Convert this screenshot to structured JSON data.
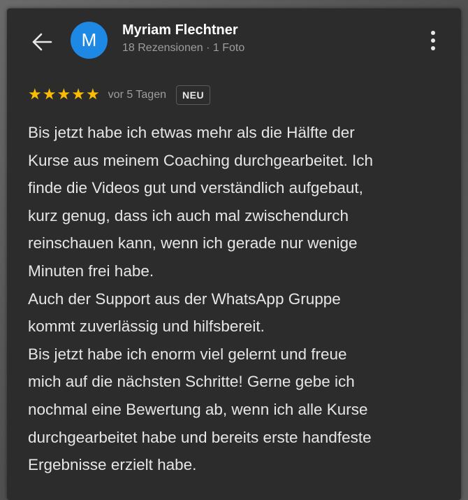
{
  "colors": {
    "card_background": "#2c2c2c",
    "avatar": "#1e88e5",
    "star": "#fbbc04",
    "text_primary": "#ffffff",
    "text_secondary": "#9e9e9e"
  },
  "header": {
    "back_icon": "arrow-left-icon",
    "avatar_letter": "M",
    "reviewer_name": "Myriam Flechtner",
    "reviewer_meta": "18 Rezensionen · 1 Foto",
    "more_icon": "more-vertical-icon"
  },
  "review": {
    "rating": 5,
    "max_rating": 5,
    "stars": [
      "★",
      "★",
      "★",
      "★",
      "★"
    ],
    "date": "vor 5 Tagen",
    "badge": "NEU",
    "lines": [
      "Bis jetzt habe ich etwas mehr als die Hälfte der",
      "Kurse aus meinem Coaching durchgearbeitet. Ich",
      "finde die Videos gut und verständlich aufgebaut,",
      "kurz genug, dass ich auch mal zwischendurch",
      "reinschauen kann, wenn ich gerade nur wenige",
      "Minuten frei habe.",
      "Auch der Support aus der WhatsApp Gruppe",
      "kommt zuverlässig und hilfsbereit.",
      "Bis jetzt habe ich enorm viel gelernt und freue",
      "mich auf die nächsten Schritte! Gerne gebe ich",
      "nochmal eine Bewertung ab, wenn ich alle Kurse",
      "durchgearbeitet habe und bereits erste handfeste",
      "Ergebnisse erzielt habe."
    ]
  }
}
